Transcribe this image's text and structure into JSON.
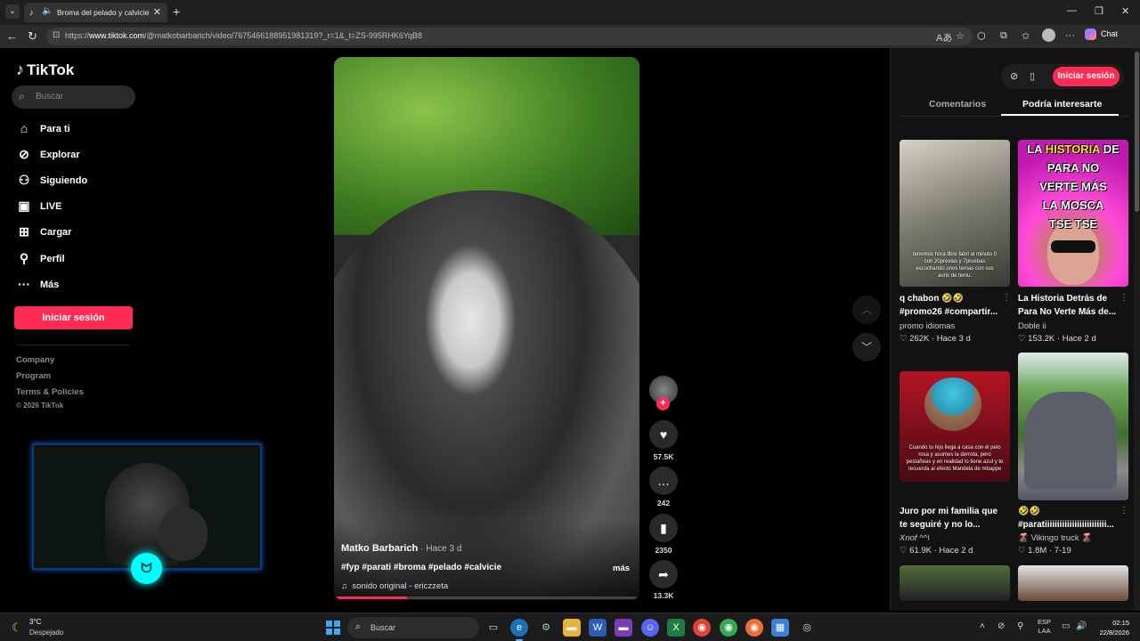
{
  "browser": {
    "tab_title": "Broma del pelado y calvicie –",
    "url_prefix": "https://",
    "url_host": "www.tiktok.com",
    "url_path": "/@matkobarbarich/video/7675466188951981319?_r=1&_t=ZS-995RHK6YqB8",
    "chat_label": "Chat"
  },
  "sidebar": {
    "logo": "TikTok",
    "search_placeholder": "Buscar",
    "menu": [
      {
        "label": "Para ti",
        "icon": "home-icon"
      },
      {
        "label": "Explorar",
        "icon": "compass-icon"
      },
      {
        "label": "Siguiendo",
        "icon": "following-icon"
      },
      {
        "label": "LIVE",
        "icon": "live-icon"
      },
      {
        "label": "Cargar",
        "icon": "upload-icon"
      },
      {
        "label": "Perfil",
        "icon": "profile-icon"
      },
      {
        "label": "Más",
        "icon": "more-icon"
      }
    ],
    "login_label": "Iniciar sesión",
    "footer": [
      "Company",
      "Program",
      "Terms & Policies"
    ],
    "copyright": "© 2026 TikTok"
  },
  "video": {
    "author": "Matko Barbarich",
    "time": "· Hace 3 d",
    "tags": "#fyp #parati #broma #pelado #calvicie",
    "more": "más",
    "sound": "sonido original - ericzzeta",
    "progress_fraction": 0.24
  },
  "actions": {
    "likes": "57.5K",
    "comments": "242",
    "saves": "2350",
    "shares": "13.3K"
  },
  "right_panel": {
    "login_label": "Iniciar sesión",
    "tabs": [
      "Comentarios",
      "Podría interesarte"
    ],
    "thumb2_title_line1a": "LA ",
    "thumb2_title_line1b": "HISTORIA",
    "thumb2_title_line1c": " DE",
    "thumb2_title_rest": [
      "PARA NO",
      "VERTE MÁS",
      "LA MOSCA",
      "TSE TSE"
    ],
    "thumb1_caption": "tenemos hora libre fabri al minuto 0 con 20previas y 7pruebas escuchando unos temas con sus auris de temu:",
    "thumb3_caption": "Cuando tu hijo llega a casa con el pelo rosa y asumes la derrota, pero pestañeas y en realidad lo tiene azul y te recuerda al efecto Mandela de mbappe",
    "cards": [
      {
        "title_l1": "q chabon 🤣🤣",
        "title_l2": "#promo26 #compartir...",
        "author": "promo idiomas",
        "stats": "♡ 262K · Hace 3 d"
      },
      {
        "title_l1": "La Historia Detrás de",
        "title_l2": "Para No Verte Más de...",
        "author": "Doble ii",
        "stats": "♡ 153.2K · Hace 2 d"
      },
      {
        "title_l1": "Juro por mi familia que",
        "title_l2": "te seguiré y no lo...",
        "author": "Xnof ^^\\",
        "stats": "♡ 61.9K · Hace 2 d"
      },
      {
        "title_l1": "🤣🤣",
        "title_l2": "#paratiiiiiiiiiiiiiiiiiiiiiiiii...",
        "author": "🌋 Vikingo truck 🌋",
        "stats": "♡ 1.8M · 7-19"
      }
    ]
  },
  "taskbar": {
    "temp": "3°C",
    "weather": "Despejado",
    "search_placeholder": "Buscar",
    "lang_l1": "ESP",
    "lang_l2": "LAA",
    "time": "02:15",
    "date": "22/8/2026"
  },
  "colors": {
    "accent": "#fe2c55",
    "background": "#000000",
    "panel": "#121212"
  }
}
